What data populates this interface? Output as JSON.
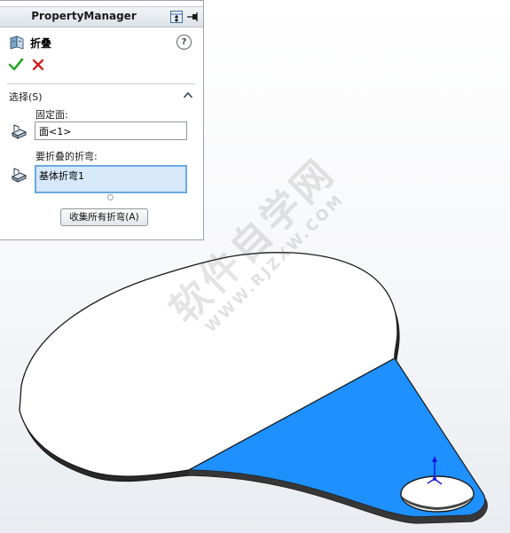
{
  "property_manager": {
    "title": "PropertyManager",
    "feature_title": "折叠",
    "help_glyph": "?",
    "ok_icon": "check-icon",
    "cancel_icon": "close-icon",
    "section": {
      "title": "选择(S)",
      "collapse_icon": "chevron-up-icon"
    },
    "fixed_face": {
      "label": "固定面:",
      "value": "面<1>",
      "icon": "face-selection-icon"
    },
    "bends": {
      "label": "要折叠的折弯:",
      "items": [
        "基体折弯1"
      ],
      "icon": "face-selection-icon"
    },
    "collect_all_bends_label": "收集所有折弯(A)"
  },
  "viewport": {
    "part_fill_color": "#ffffff",
    "selected_face_color": "#1e90ff",
    "edge_color": "#1a1a1a",
    "triad_axis_color": "#1515e0"
  },
  "watermark": {
    "text": "软件自学网",
    "url": "WWW.RJZXW.COM"
  }
}
